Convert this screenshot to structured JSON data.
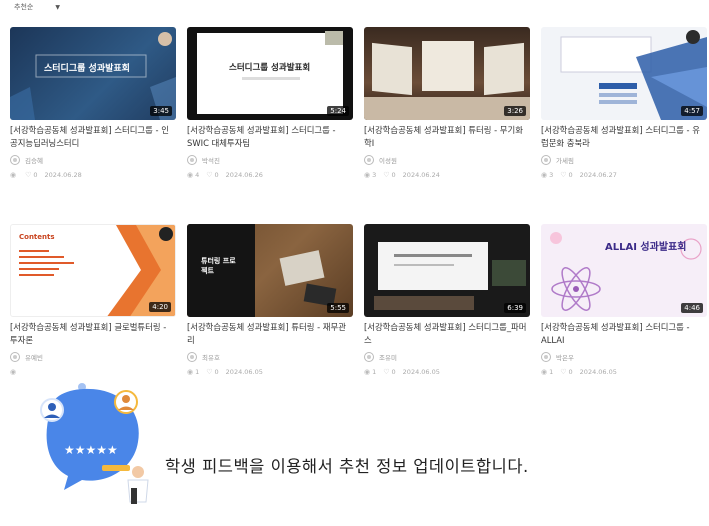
{
  "sort": {
    "label": "추천순"
  },
  "videos": [
    {
      "duration": "3:45",
      "title": "[서강학습공동체 성과발표회] 스터디그룹 - 인공지능딥러닝스터디",
      "author": "김승혜",
      "views": "",
      "likes": "0",
      "date": "2024.06.28",
      "thumb_text": "스터디그룹 성과발표회"
    },
    {
      "duration": "5:24",
      "title": "[서강학습공동체 성과발표회] 스터디그룹 - SWIC 대체투자팀",
      "author": "박석진",
      "views": "4",
      "likes": "0",
      "date": "2024.06.26",
      "thumb_text": "스터디그룹 성과발표회"
    },
    {
      "duration": "3:26",
      "title": "[서강학습공동체 성과발표회] 튜터링 - 무기화학I",
      "author": "이성원",
      "views": "3",
      "likes": "0",
      "date": "2024.06.24",
      "thumb_text": ""
    },
    {
      "duration": "4:57",
      "title": "[서강학습공동체 성과발표회] 스터디그룹 - 유럽문화 충북라",
      "author": "가세림",
      "views": "3",
      "likes": "0",
      "date": "2024.06.27",
      "thumb_text": ""
    },
    {
      "duration": "4:20",
      "title": "[서강학습공동체 성과발표회] 글로벌튜터링 - 투자론",
      "author": "유예빈",
      "views": "",
      "likes": "",
      "date": "",
      "thumb_text": "Contents"
    },
    {
      "duration": "5:55",
      "title": "[서강학습공동체 성과발표회] 튜터링 - 재무관리",
      "author": "최유호",
      "views": "1",
      "likes": "0",
      "date": "2024.06.05",
      "thumb_text": "튜터링 프로젝트"
    },
    {
      "duration": "6:39",
      "title": "[서강학습공동체 성과발표회] 스터디그룹_파머스",
      "author": "조유미",
      "views": "1",
      "likes": "0",
      "date": "2024.06.05",
      "thumb_text": ""
    },
    {
      "duration": "4:46",
      "title": "[서강학습공동체 성과발표회] 스터디그룹 - ALLAI",
      "author": "박은우",
      "views": "1",
      "likes": "0",
      "date": "2024.06.05",
      "thumb_text": "ALLAI 성과발표회"
    }
  ],
  "footer": {
    "message": "학생 피드백을 이용해서 추천 정보 업데이트합니다."
  },
  "colors": {
    "accent": "#4a86e8",
    "rating": "#f5b93d"
  }
}
